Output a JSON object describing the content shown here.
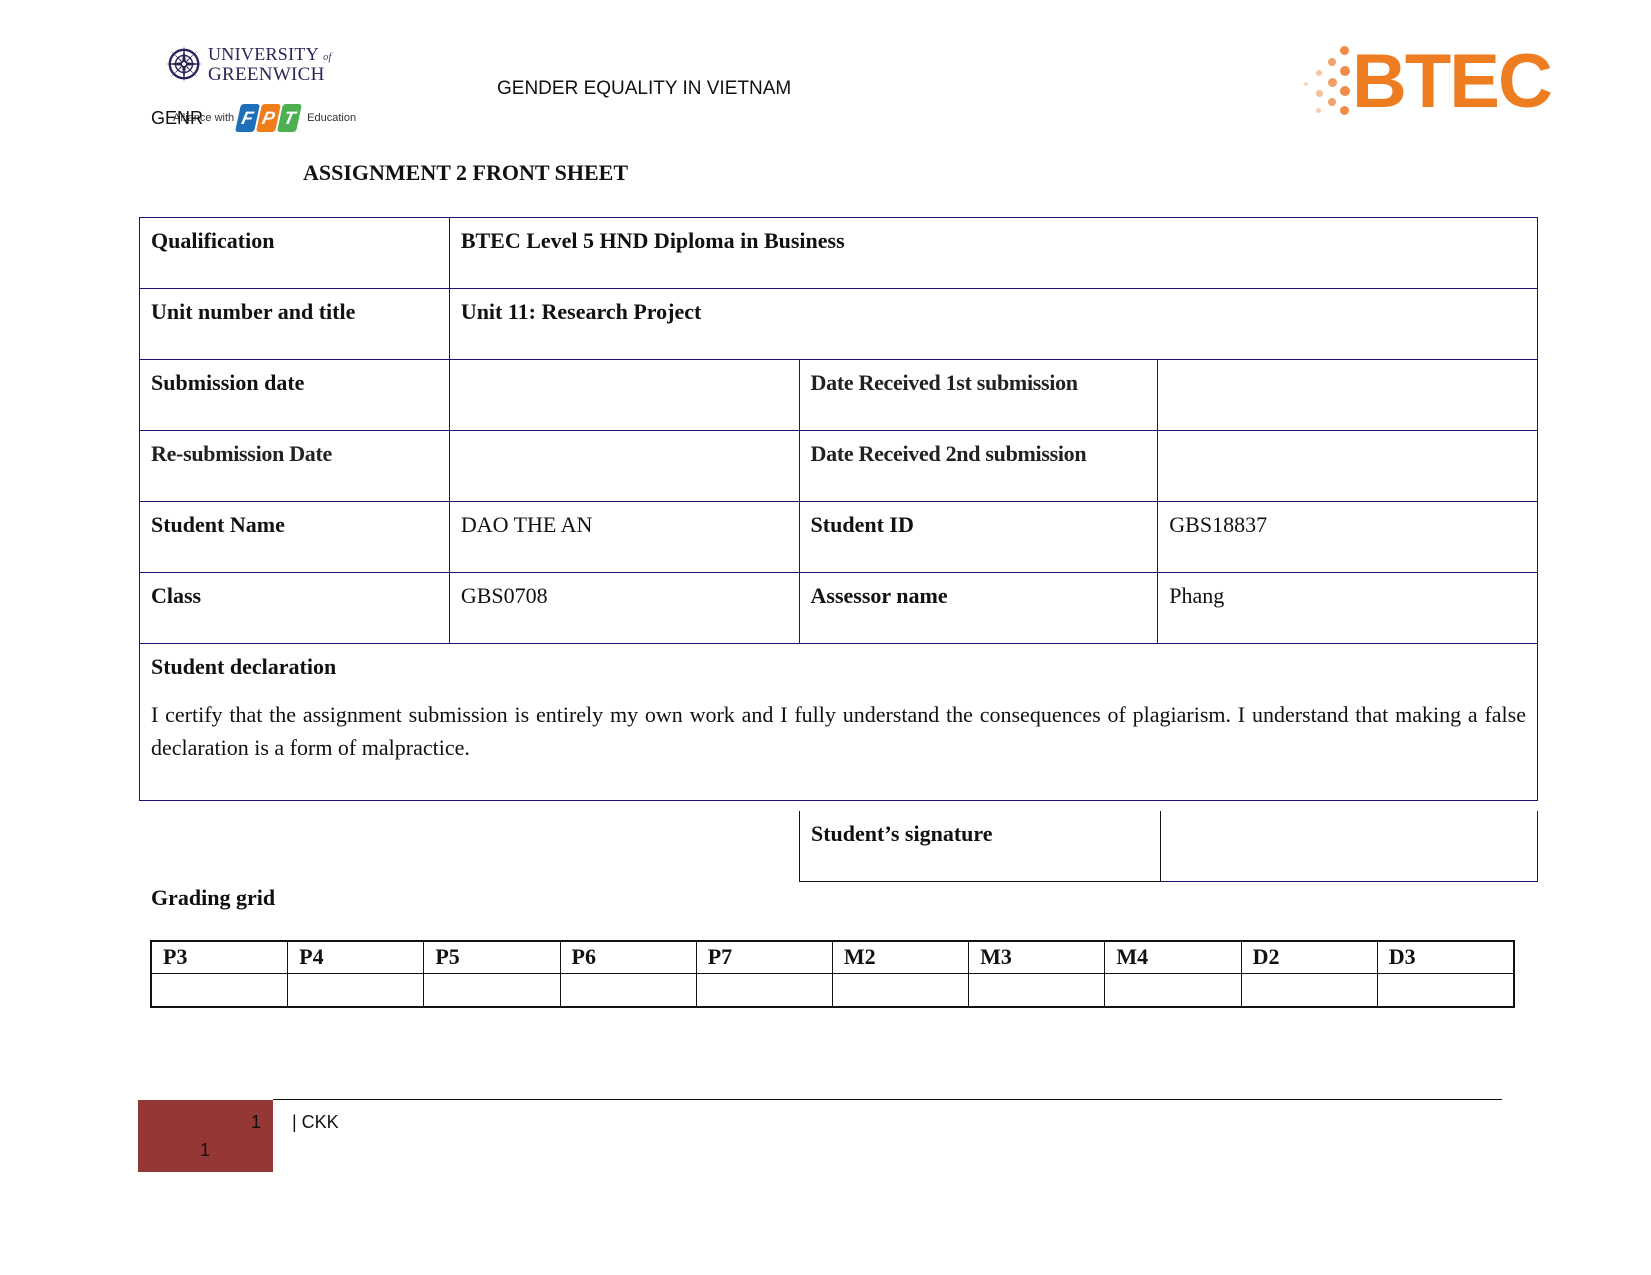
{
  "header": {
    "university_logo": {
      "line1": "UNIVERSITY",
      "of": "of",
      "line2": "GREENWICH",
      "icon": "compass-rose-icon"
    },
    "overlay_text": "GENR",
    "alliance_text": "Alliance with",
    "fpt_logo": {
      "letters": [
        "F",
        "P",
        "T"
      ],
      "suffix": "Education",
      "colors": [
        "#1f6fb8",
        "#ef7d1a",
        "#4caf50"
      ]
    },
    "title": "GENDER EQUALITY IN VIETNAM",
    "btec_logo": {
      "text": "BTEC",
      "color": "#ee7d22"
    }
  },
  "sheet_title": "ASSIGNMENT 2 FRONT SHEET",
  "front_sheet": {
    "qualification": {
      "label": "Qualification",
      "value": "BTEC Level 5 HND Diploma in Business"
    },
    "unit": {
      "label": "Unit number and title",
      "value": "Unit 11: Research Project"
    },
    "submission_date": {
      "label": "Submission date",
      "value": ""
    },
    "date_received_1": {
      "label": "Date Received 1st submission",
      "value": ""
    },
    "resubmission_date": {
      "label": "Re-submission Date",
      "value": ""
    },
    "date_received_2": {
      "label": "Date Received 2nd submission",
      "value": ""
    },
    "student_name": {
      "label": "Student Name",
      "value": "DAO THE AN"
    },
    "student_id": {
      "label": "Student ID",
      "value": "GBS18837"
    },
    "class": {
      "label": "Class",
      "value": "GBS0708"
    },
    "assessor": {
      "label": "Assessor name",
      "value": "Phang"
    },
    "declaration": {
      "label": "Student declaration",
      "text": "I certify that the assignment submission is entirely my own work and I fully understand the consequences of plagiarism. I understand that making a false declaration is a form of malpractice."
    },
    "signature": {
      "label": "Student’s signature",
      "value": ""
    }
  },
  "grading_grid": {
    "title": "Grading grid",
    "headers": [
      "P3",
      "P4",
      "P5",
      "P6",
      "P7",
      "M2",
      "M3",
      "M4",
      "D2",
      "D3"
    ],
    "values": [
      "",
      "",
      "",
      "",
      "",
      "",
      "",
      "",
      "",
      ""
    ]
  },
  "footer": {
    "page_number_top": "1",
    "page_number_bottom": "1",
    "text": "| CKK",
    "box_color": "#953735"
  }
}
